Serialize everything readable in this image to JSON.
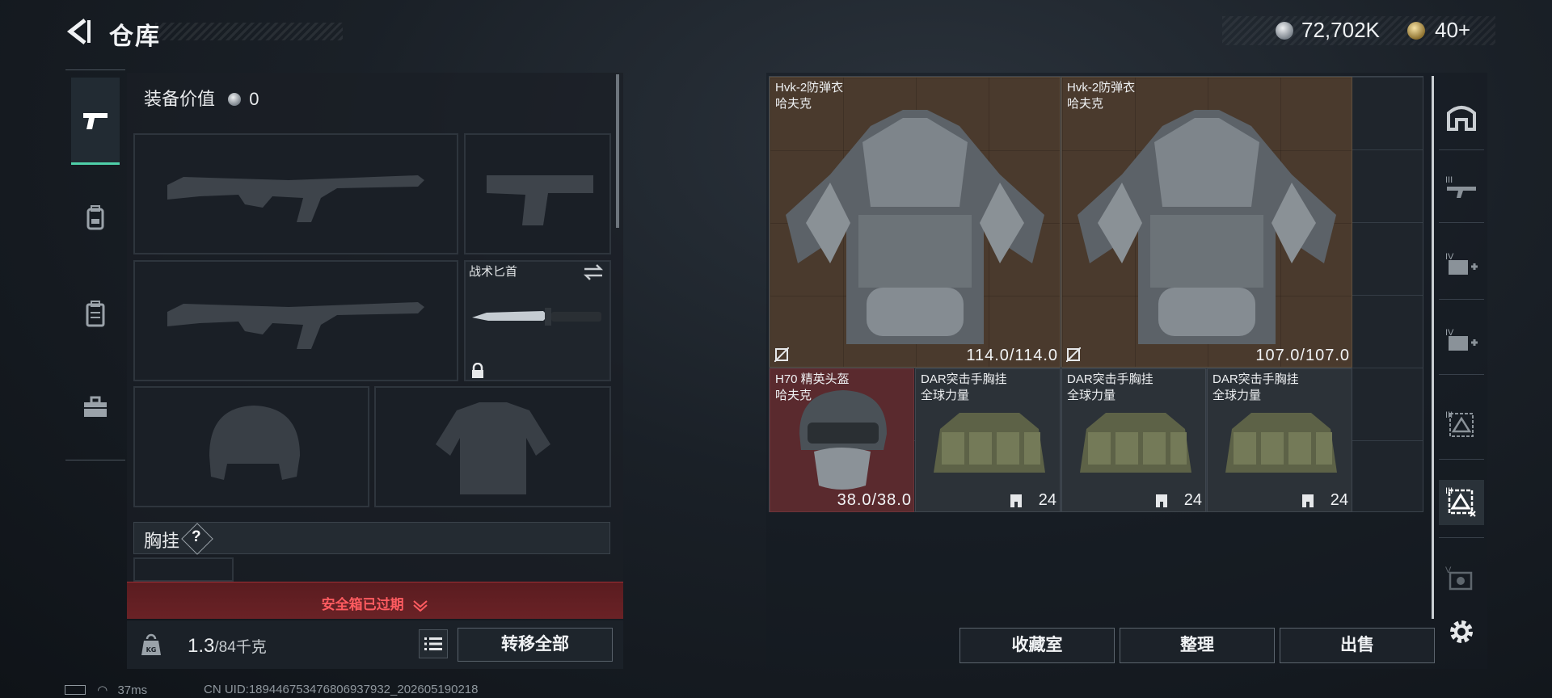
{
  "header": {
    "title": "仓库",
    "currency_main": "72,702K",
    "currency_secondary": "40+"
  },
  "loadout": {
    "equip_value_label": "装备价值",
    "equip_value": "0",
    "knife_label": "战术匕首",
    "chest_rig_label": "胸挂",
    "chest_rig_badge": "?",
    "safe_box_status": "安全箱已过期",
    "weight_current": "1.3",
    "weight_max": "/84千克",
    "transfer_all": "转移全部"
  },
  "storage": {
    "items": [
      {
        "name": "Hvk-2防弹衣",
        "brand": "哈夫克",
        "durability": "114.0/114.0"
      },
      {
        "name": "Hvk-2防弹衣",
        "brand": "哈夫克",
        "durability": "107.0/107.0"
      },
      {
        "name": "H70 精英头盔",
        "brand": "哈夫克",
        "durability": "38.0/38.0"
      },
      {
        "name": "DAR突击手胸挂",
        "brand": "全球力量",
        "count": "24"
      },
      {
        "name": "DAR突击手胸挂",
        "brand": "全球力量",
        "count": "24"
      },
      {
        "name": "DAR突击手胸挂",
        "brand": "全球力量",
        "count": "24"
      }
    ],
    "buttons": {
      "collection": "收藏室",
      "organize": "整理",
      "sell": "出售"
    },
    "category_labels": [
      "III",
      "IV",
      "IV",
      "III",
      "III",
      "V"
    ]
  },
  "status": {
    "ping": "37ms",
    "uid": "CN UID:18944675347680693793​2_202605190218"
  },
  "colors": {
    "accent": "#4fd0a9",
    "item_brown": "#4a3a2d",
    "item_red": "#5a2a2e",
    "warning": "#ff5b60"
  }
}
